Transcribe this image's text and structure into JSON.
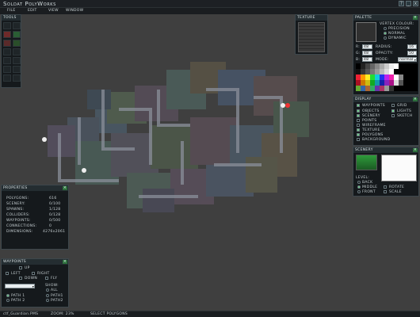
{
  "app": {
    "title": "Soldat PolyWorks"
  },
  "menu": [
    "File",
    "Edit",
    "View",
    "Window"
  ],
  "window_buttons": {
    "help": "?",
    "minimize": "_",
    "close": "x"
  },
  "tools": {
    "title": "Tools"
  },
  "texture": {
    "title": "Texture"
  },
  "palette": {
    "title": "Palette",
    "vertex_colour_label": "Vertex Colour:",
    "precision_label": "Precision",
    "normal_label": "Normal",
    "dynamic_label": "Dynamic",
    "r_label": "R:",
    "r_value": "48",
    "g_label": "G:",
    "g_value": "48",
    "b_label": "B:",
    "b_value": "48",
    "radius_label": "Radius:",
    "radius_value": "16",
    "opacity_label": "Opacity:",
    "opacity_value": "50",
    "mode_label": "Mode:",
    "mode_value": "normal",
    "swatch_color": "#303030"
  },
  "display": {
    "title": "Display",
    "items": [
      "Waypoints",
      "Objects",
      "Scenery",
      "Points",
      "Wireframe",
      "Texture",
      "Polygons",
      "Background"
    ],
    "items2": [
      "Grid",
      "Lights",
      "Sketch"
    ]
  },
  "scenery": {
    "title": "Scenery",
    "level_label": "Level:",
    "back_label": "Back",
    "middle_label": "Middle",
    "front_label": "Front",
    "rotate_label": "Rotate",
    "scale_label": "Scale"
  },
  "properties": {
    "title": "Properties",
    "rows": [
      {
        "label": "Polygons:",
        "value": "616"
      },
      {
        "label": "Scenery:",
        "value": "0/100"
      },
      {
        "label": "Spawns:",
        "value": "1/128"
      },
      {
        "label": "Colliders:",
        "value": "0/128"
      },
      {
        "label": "Waypoints:",
        "value": "0/500"
      },
      {
        "label": "Connections:",
        "value": "0"
      },
      {
        "label": "Dimensions:",
        "value": "4276x2061"
      }
    ]
  },
  "waypoints": {
    "title": "Waypoints",
    "up_label": "Up",
    "left_label": "Left",
    "right_label": "Right",
    "down_label": "Down",
    "fly_label": "Fly",
    "show_label": "Show:",
    "all_label": "All",
    "path1_label": "Path 1",
    "path2_label": "Path 2",
    "show_path1_label": "Path1",
    "show_path2_label": "Path2"
  },
  "status": {
    "file": "ctf_Guardian.PMS",
    "zoom": "Zoom: 23%",
    "tool": "Select Polygons"
  },
  "colors": {
    "panel_bg": "#15191c",
    "accent_green": "#2c6e3b",
    "map_bg": "#3f3f3f"
  }
}
